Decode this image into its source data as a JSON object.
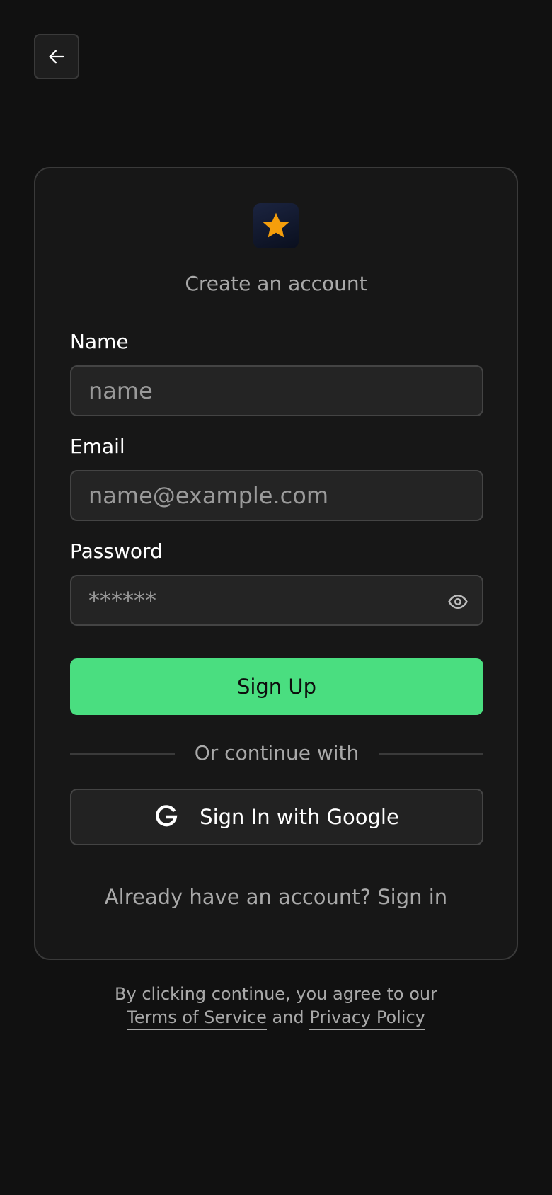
{
  "header": {
    "back_icon": "arrow-left-icon"
  },
  "card": {
    "logo_icon": "star-icon",
    "subtitle": "Create an account",
    "fields": {
      "name": {
        "label": "Name",
        "placeholder": "name"
      },
      "email": {
        "label": "Email",
        "placeholder": "name@example.com"
      },
      "password": {
        "label": "Password",
        "placeholder": "******",
        "toggle_icon": "eye-icon"
      }
    },
    "signup_label": "Sign Up",
    "divider_text": "Or continue with",
    "google": {
      "icon": "google-icon",
      "label": "Sign In with Google"
    },
    "signin": {
      "prompt": "Already have an account?",
      "link": "Sign in"
    }
  },
  "legal": {
    "line1": "By clicking continue, you agree to our",
    "terms": "Terms of Service",
    "and": "and",
    "privacy": "Privacy Policy"
  },
  "colors": {
    "background": "#111111",
    "card": "#171717",
    "accent": "#4ade80",
    "star": "#f59e0b"
  }
}
